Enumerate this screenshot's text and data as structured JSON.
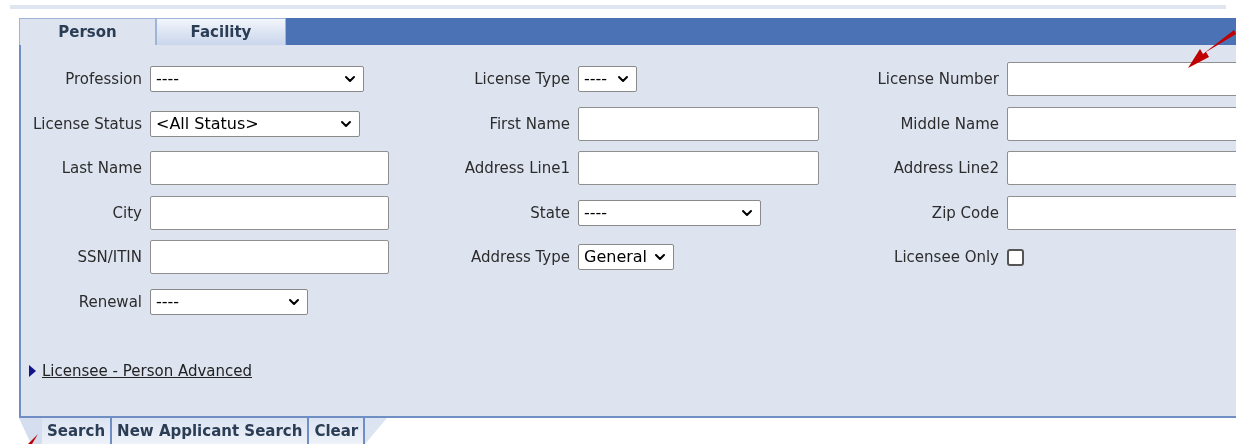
{
  "tabs": [
    {
      "label": "Person",
      "selected": true
    },
    {
      "label": "Facility",
      "selected": false
    }
  ],
  "fields": [
    {
      "kind": "select",
      "label": "Profession",
      "value": "----"
    },
    {
      "kind": "select",
      "label": "License Type",
      "value": "----"
    },
    {
      "kind": "text",
      "label": "License Number"
    },
    {
      "kind": "select",
      "label": "License Status",
      "value": "<All Status>"
    },
    {
      "kind": "text",
      "label": "First Name"
    },
    {
      "kind": "text",
      "label": "Middle Name"
    },
    {
      "kind": "text",
      "label": "Last Name"
    },
    {
      "kind": "text",
      "label": "Address Line1"
    },
    {
      "kind": "text",
      "label": "Address Line2"
    },
    {
      "kind": "text",
      "label": "City"
    },
    {
      "kind": "select",
      "label": "State",
      "value": "----"
    },
    {
      "kind": "text",
      "label": "Zip Code"
    },
    {
      "kind": "text",
      "label": "SSN/ITIN"
    },
    {
      "kind": "select",
      "label": "Address Type",
      "value": "General"
    },
    {
      "kind": "checkbox",
      "label": "Licensee Only",
      "checked": false
    },
    {
      "kind": "select",
      "label": "Renewal",
      "value": "----"
    }
  ],
  "advanced_link": {
    "label": "Licensee - Person Advanced",
    "expanded": false
  },
  "buttons": [
    "Search",
    "New Applicant Search",
    "Clear"
  ]
}
